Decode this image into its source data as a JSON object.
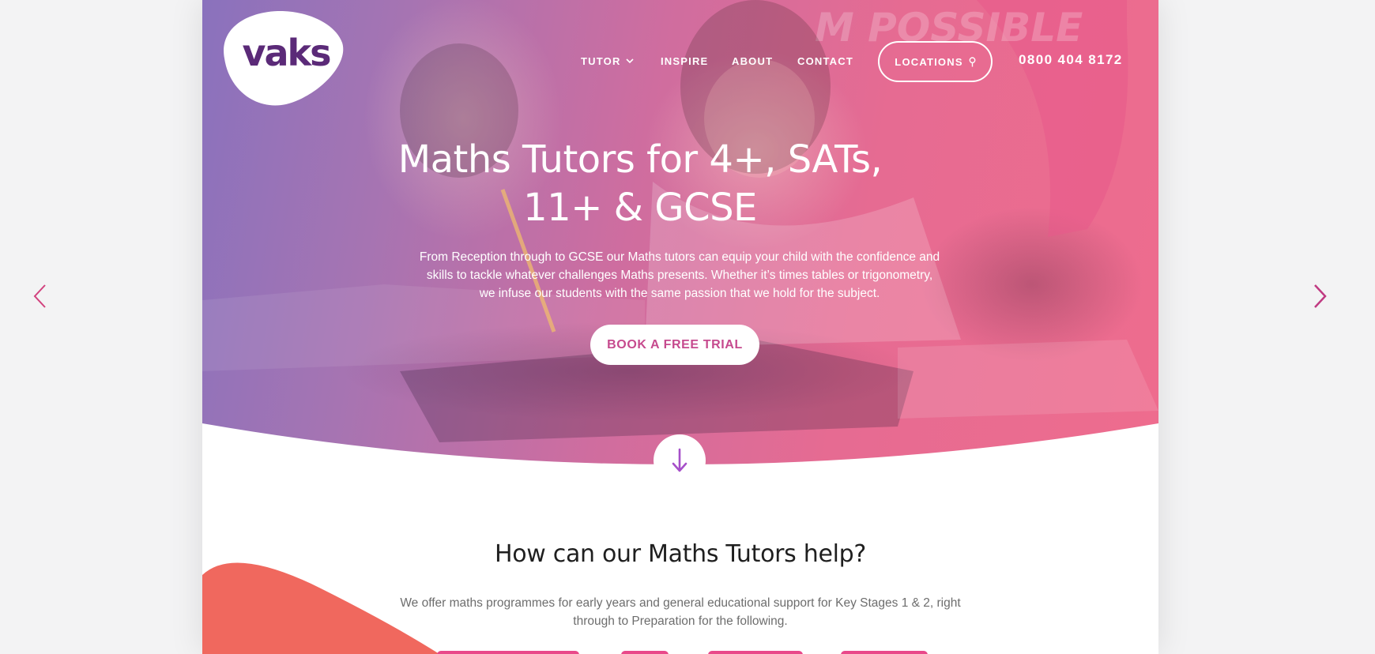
{
  "logo": {
    "text": "vaks"
  },
  "nav": {
    "tutor": "TUTOR",
    "inspire": "INSPIRE",
    "about": "ABOUT",
    "contact": "CONTACT",
    "locations": "LOCATIONS",
    "phone": "0800 404 8172"
  },
  "hero": {
    "title_line1": "Maths Tutors for 4+, SATs,",
    "title_line2": "11+ & GCSE",
    "text": "From Reception through to GCSE our Maths tutors can equip your child with the confidence and skills to tackle whatever challenges Maths presents. Whether it’s times tables or trigonometry, we infuse our students with the same passion that we hold for the subject.",
    "cta": "BOOK A FREE TRIAL",
    "background_text": "M POSSIBLE"
  },
  "section": {
    "title": "How can our Maths Tutors help?",
    "text": "We offer maths programmes for early years and general educational support for Key Stages 1 & 2, right through to Preparation for the following."
  },
  "colors": {
    "page_bg": "#f3f3f4",
    "gradient_start": "#8a72bd",
    "gradient_end": "#ee6c8e",
    "logo_purple": "#5b2a78",
    "cta_text": "#c64a8e",
    "arrow_purple": "#a64fc9",
    "coral": "#f0685e",
    "tab_pink": "#e9498a",
    "gallery_arrow": "#d2427e"
  },
  "icons": {
    "gallery_prev": "chevron-left-icon",
    "gallery_next": "chevron-right-icon",
    "tutor_dropdown": "chevron-down-icon",
    "location": "map-pin-icon",
    "scroll": "arrow-down-icon"
  }
}
